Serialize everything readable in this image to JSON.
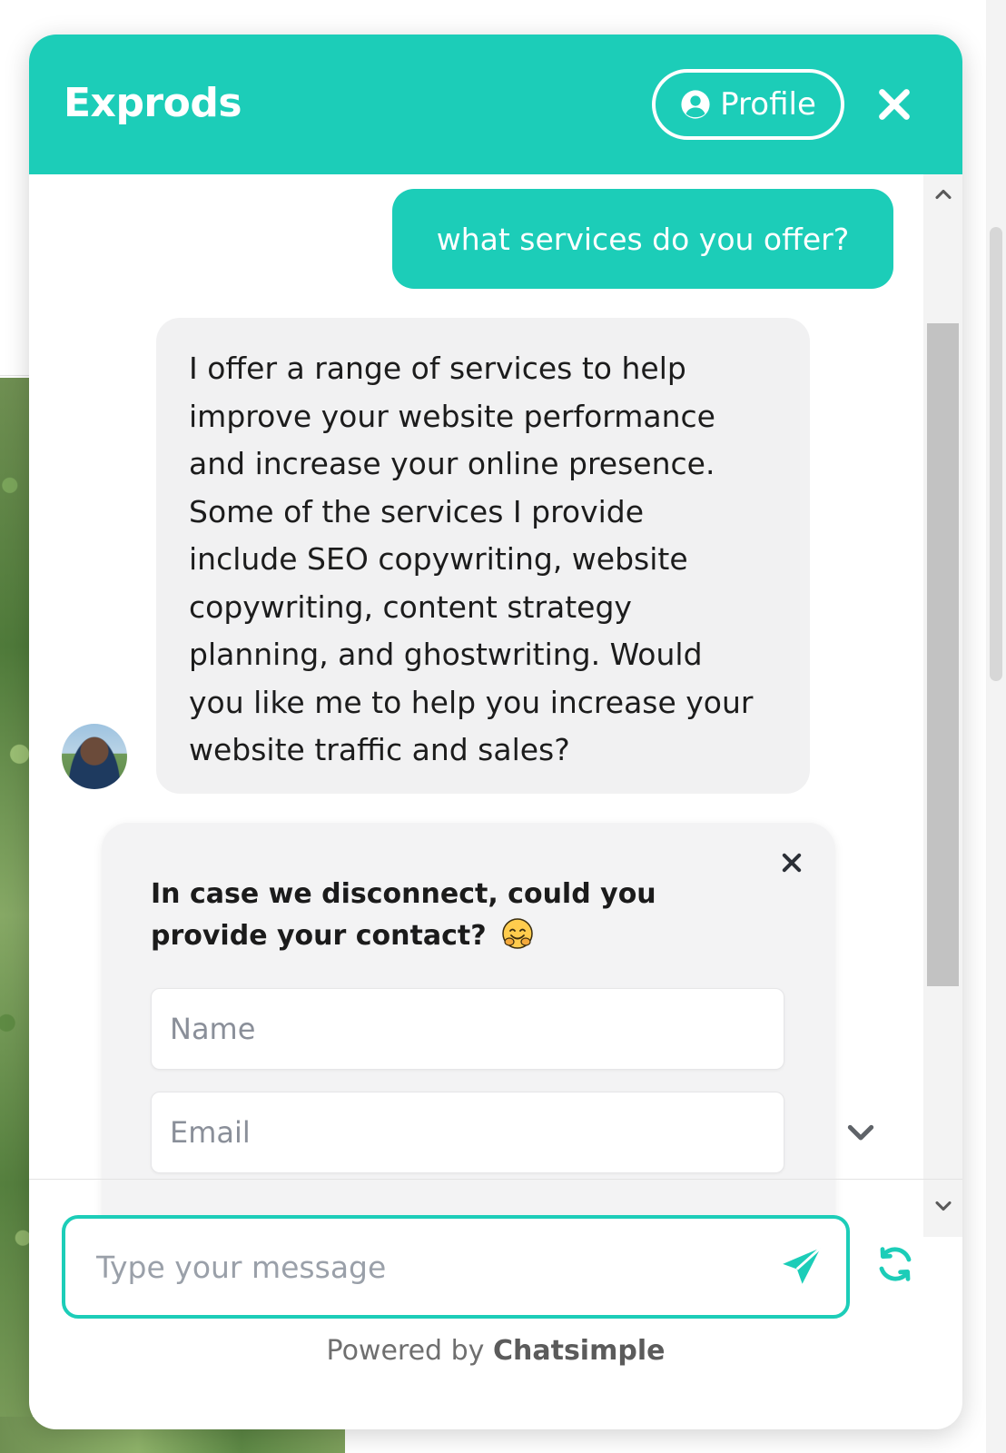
{
  "header": {
    "brand": "Exprods",
    "profile_label": "Profile"
  },
  "conversation": {
    "user_message": "what services do you offer?",
    "bot_message": "I offer a range of services to help\nimprove your website performance\nand increase your online presence.\nSome of the services I provide\ninclude SEO copywriting, website\ncopywriting, content strategy\nplanning, and ghostwriting. Would\nyou like me to help you increase your\nwebsite traffic and sales?"
  },
  "contact_form": {
    "title": "In case we disconnect, could you provide your contact?",
    "emoji_icon": "hugging-face-emoji",
    "name_placeholder": "Name",
    "email_placeholder": "Email"
  },
  "composer": {
    "placeholder": "Type your message"
  },
  "footer": {
    "powered_prefix": "Powered by",
    "powered_brand": "Chatsimple"
  },
  "icons": {
    "profile": "user-circle-icon",
    "close": "close-icon",
    "scroll_up": "chevron-up-icon",
    "scroll_down": "chevron-down-icon",
    "jump_down": "chevron-down-icon",
    "send": "paper-plane-icon",
    "refresh": "refresh-icon"
  },
  "colors": {
    "accent": "#1ccdb8",
    "bot_bubble": "#f1f1f2",
    "text": "#1c1c1c"
  }
}
